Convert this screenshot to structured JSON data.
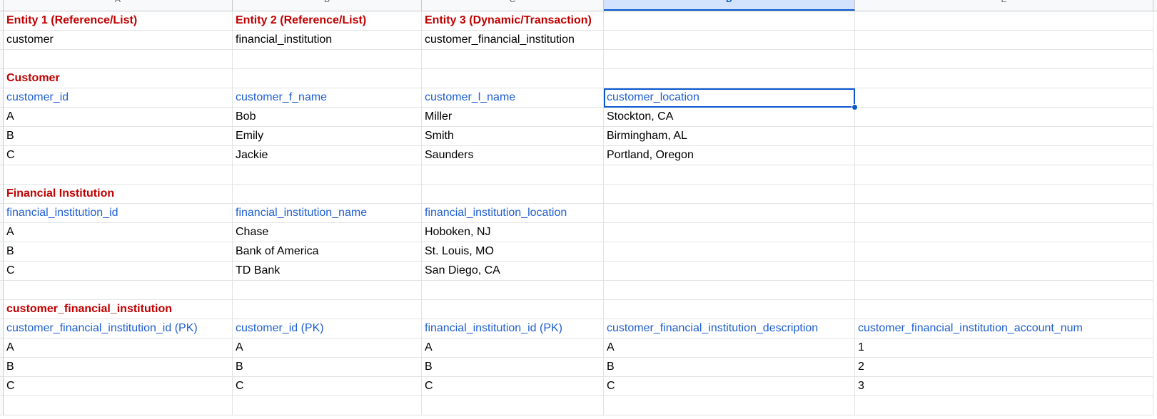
{
  "colors": {
    "section_title": "#c00000",
    "field_header": "#1f5fd1",
    "selection": "#0b57d0"
  },
  "column_headers": [
    "A",
    "B",
    "C",
    "D",
    "E"
  ],
  "selected_column": "D",
  "selected_cell": "D5",
  "rows": [
    {
      "style": "bold-red",
      "cells": [
        "Entity 1 (Reference/List)",
        "Entity 2 (Reference/List)",
        "Entity 3 (Dynamic/Transaction)",
        "",
        ""
      ]
    },
    {
      "style": "plain",
      "cells": [
        "customer",
        "financial_institution",
        "customer_financial_institution",
        "",
        ""
      ]
    },
    {
      "style": "plain",
      "cells": [
        "",
        "",
        "",
        "",
        ""
      ]
    },
    {
      "style": "bold-red",
      "cells": [
        "Customer",
        "",
        "",
        "",
        ""
      ]
    },
    {
      "style": "blue",
      "cells": [
        "customer_id",
        "customer_f_name",
        "customer_l_name",
        "customer_location",
        ""
      ]
    },
    {
      "style": "plain",
      "cells": [
        "A",
        "Bob",
        "Miller",
        "Stockton, CA",
        ""
      ]
    },
    {
      "style": "plain",
      "cells": [
        "B",
        "Emily",
        "Smith",
        "Birmingham, AL",
        ""
      ]
    },
    {
      "style": "plain",
      "cells": [
        "C",
        "Jackie",
        "Saunders",
        "Portland, Oregon",
        ""
      ]
    },
    {
      "style": "plain",
      "cells": [
        "",
        "",
        "",
        "",
        ""
      ]
    },
    {
      "style": "bold-red",
      "cells": [
        "Financial Institution",
        "",
        "",
        "",
        ""
      ]
    },
    {
      "style": "blue",
      "cells": [
        "financial_institution_id",
        "financial_institution_name",
        "financial_institution_location",
        "",
        ""
      ]
    },
    {
      "style": "plain",
      "cells": [
        "A",
        "Chase",
        "Hoboken, NJ",
        "",
        ""
      ]
    },
    {
      "style": "plain",
      "cells": [
        "B",
        "Bank of America",
        "St. Louis, MO",
        "",
        ""
      ]
    },
    {
      "style": "plain",
      "cells": [
        "C",
        "TD Bank",
        "San Diego, CA",
        "",
        ""
      ]
    },
    {
      "style": "plain",
      "cells": [
        "",
        "",
        "",
        "",
        ""
      ]
    },
    {
      "style": "bold-red",
      "cells": [
        "customer_financial_institution",
        "",
        "",
        "",
        ""
      ]
    },
    {
      "style": "blue",
      "cells": [
        "customer_financial_institution_id (PK)",
        "customer_id (PK)",
        "financial_institution_id (PK)",
        "customer_financial_institution_description",
        "customer_financial_institution_account_num"
      ]
    },
    {
      "style": "plain",
      "cells": [
        "A",
        "A",
        "A",
        "A",
        "1"
      ]
    },
    {
      "style": "plain",
      "cells": [
        "B",
        "B",
        "B",
        "B",
        "2"
      ]
    },
    {
      "style": "plain",
      "cells": [
        "C",
        "C",
        "C",
        "C",
        "3"
      ]
    },
    {
      "style": "plain",
      "cells": [
        "",
        "",
        "",
        "",
        ""
      ]
    }
  ]
}
